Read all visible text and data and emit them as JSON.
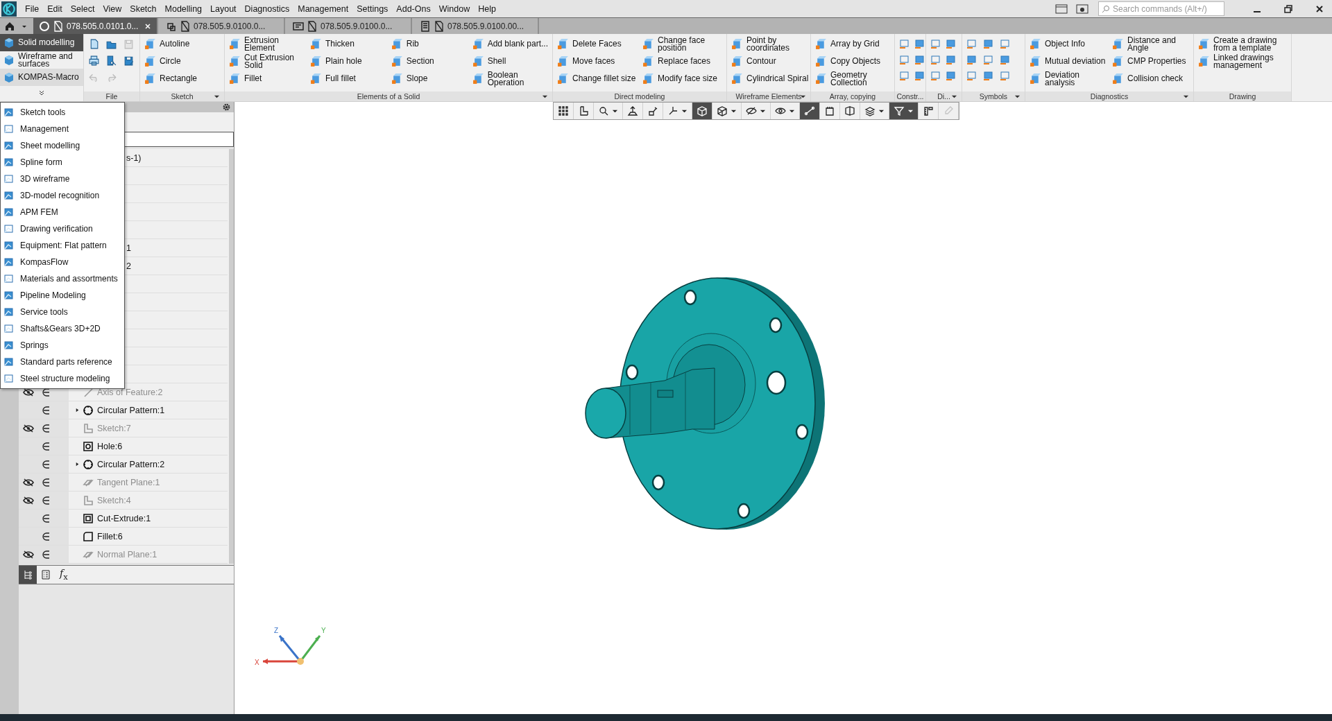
{
  "menu": [
    "File",
    "Edit",
    "Select",
    "View",
    "Sketch",
    "Modelling",
    "Layout",
    "Diagnostics",
    "Management",
    "Settings",
    "Add-Ons",
    "Window",
    "Help"
  ],
  "search": {
    "placeholder": "Search commands (Alt+/)"
  },
  "doc_tabs": [
    {
      "label": "078.505.0.0101.0...",
      "selected": true,
      "kind": "part"
    },
    {
      "label": "078.505.9.0100.0...",
      "selected": false,
      "kind": "assembly"
    },
    {
      "label": "078.505.9.0100.0...",
      "selected": false,
      "kind": "spec"
    },
    {
      "label": "078.505.9.0100.00...",
      "selected": false,
      "kind": "document"
    }
  ],
  "modes": [
    {
      "label": "Solid modelling",
      "selected": true
    },
    {
      "label": "Wireframe and surfaces",
      "selected": false
    },
    {
      "label": "KOMPAS-Macro",
      "selected": false
    }
  ],
  "groups": [
    {
      "kind": "file",
      "label": "File",
      "has_menu": false,
      "tools": [
        {
          "kind": "new",
          "disabled": false
        },
        {
          "kind": "open",
          "disabled": false
        },
        {
          "kind": "save",
          "disabled": true
        },
        {
          "kind": "print",
          "disabled": false
        },
        {
          "kind": "preview",
          "disabled": false
        },
        {
          "kind": "saveas",
          "disabled": false
        },
        {
          "kind": "undo",
          "disabled": true
        },
        {
          "kind": "redo",
          "disabled": true
        }
      ]
    },
    {
      "kind": "text",
      "label": "Sketch",
      "has_menu": true,
      "columns": [
        [
          "Autoline",
          "Circle",
          "Rectangle"
        ]
      ]
    },
    {
      "kind": "text",
      "label": "Elements of a Solid",
      "has_menu": true,
      "columns": [
        [
          "Extrusion Element",
          "Cut Extrusion Solid",
          "Fillet"
        ],
        [
          "Thicken",
          "Plain hole",
          "Full fillet"
        ],
        [
          "Rib",
          "Section",
          "Slope"
        ],
        [
          "Add blank part...",
          "Shell",
          "Boolean Operation"
        ]
      ]
    },
    {
      "kind": "text",
      "label": "Direct modeling",
      "has_menu": false,
      "columns": [
        [
          "Delete Faces",
          "Move faces",
          "Change fillet size"
        ],
        [
          "Change face position",
          "Replace faces",
          "Modify face size"
        ]
      ]
    },
    {
      "kind": "text",
      "label": "Wireframe Elements",
      "has_menu": true,
      "columns": [
        [
          "Point by coordinates",
          "Contour",
          "Cylindrical Spiral"
        ]
      ]
    },
    {
      "kind": "text",
      "label": "Array, copying",
      "has_menu": false,
      "columns": [
        [
          "Array by Grid",
          "Copy Objects",
          "Geometry Collection"
        ]
      ]
    },
    {
      "kind": "icons",
      "label": "Constr...",
      "has_menu": false
    },
    {
      "kind": "icons",
      "label": "Di...",
      "has_menu": true
    },
    {
      "kind": "icons",
      "label": "Symbols",
      "has_menu": true
    },
    {
      "kind": "text",
      "label": "Diagnostics",
      "has_menu": true,
      "columns": [
        [
          "Object Info",
          "Mutual deviation",
          "Deviation analysis"
        ],
        [
          "Distance and Angle",
          "CMP Properties",
          "Collision check"
        ]
      ]
    },
    {
      "kind": "text",
      "label": "Drawing",
      "has_menu": false,
      "columns": [
        [
          "Create a drawing from a template",
          "Linked drawings management"
        ]
      ]
    }
  ],
  "mode_menu": [
    "Sketch tools",
    "Management",
    "Sheet modelling",
    "Spline form",
    "3D wireframe",
    "3D-model recognition",
    "APM FEM",
    "Drawing verification",
    "Equipment: Flat pattern",
    "KompasFlow",
    "Materials and assortments",
    "Pipeline Modeling",
    "Service tools",
    "Shafts&Gears 3D+2D",
    "Springs",
    "Standard parts reference",
    "Steel structure modeling"
  ],
  "tree": [
    {
      "kind": "covered",
      "label": "s-1)"
    },
    {
      "kind": "covered"
    },
    {
      "kind": "covered"
    },
    {
      "kind": "covered"
    },
    {
      "kind": "covered"
    },
    {
      "kind": "covered",
      "label": "1"
    },
    {
      "kind": "covered",
      "label": "2"
    },
    {
      "kind": "covered"
    },
    {
      "kind": "covered"
    },
    {
      "kind": "covered"
    },
    {
      "kind": "covered"
    },
    {
      "kind": "covered"
    },
    {
      "kind": "covered"
    },
    {
      "kind": "axis",
      "label": "Axis of Feature:2",
      "hidden": true
    },
    {
      "kind": "pattern",
      "label": "Circular Pattern:1",
      "hidden": false,
      "expanded": false
    },
    {
      "kind": "sketch",
      "label": "Sketch:7",
      "hidden": true
    },
    {
      "kind": "hole",
      "label": "Hole:6",
      "hidden": false
    },
    {
      "kind": "pattern",
      "label": "Circular Pattern:2",
      "hidden": false,
      "expanded": false
    },
    {
      "kind": "plane",
      "label": "Tangent Plane:1",
      "hidden": true
    },
    {
      "kind": "sketch",
      "label": "Sketch:4",
      "hidden": true
    },
    {
      "kind": "extrude",
      "label": "Cut-Extrude:1",
      "hidden": false
    },
    {
      "kind": "fillet",
      "label": "Fillet:6",
      "hidden": false
    },
    {
      "kind": "plane",
      "label": "Normal Plane:1",
      "hidden": true
    }
  ],
  "tree_tabs": [
    {
      "kind": "tree",
      "selected": true
    },
    {
      "kind": "list",
      "selected": false
    },
    {
      "kind": "formula",
      "label": "*f*$_{x}$",
      "selected": false
    }
  ],
  "view_toolbar": [
    {
      "kind": "grip",
      "selected": false,
      "disabled": false,
      "menu": false
    },
    {
      "kind": "sketch",
      "selected": false,
      "disabled": false,
      "menu": false
    },
    {
      "kind": "zoom",
      "selected": false,
      "disabled": false,
      "menu": true
    },
    {
      "kind": "normal",
      "selected": false,
      "disabled": false,
      "menu": false
    },
    {
      "kind": "orient",
      "selected": false,
      "disabled": false,
      "menu": false
    },
    {
      "kind": "axes",
      "selected": false,
      "disabled": false,
      "menu": true
    },
    {
      "kind": "shaded",
      "selected": true,
      "disabled": false,
      "menu": false
    },
    {
      "kind": "wireframe",
      "selected": false,
      "disabled": false,
      "menu": true
    },
    {
      "kind": "hide",
      "selected": false,
      "disabled": false,
      "menu": true
    },
    {
      "kind": "show",
      "selected": false,
      "disabled": false,
      "menu": true
    },
    {
      "kind": "constraints",
      "selected": true,
      "disabled": false,
      "menu": false
    },
    {
      "kind": "sheet",
      "selected": false,
      "disabled": false,
      "menu": false
    },
    {
      "kind": "section",
      "selected": false,
      "disabled": false,
      "menu": false
    },
    {
      "kind": "layers",
      "selected": false,
      "disabled": false,
      "menu": true
    },
    {
      "kind": "filter",
      "selected": true,
      "disabled": false,
      "menu": true
    },
    {
      "kind": "measure",
      "selected": false,
      "disabled": false,
      "menu": false
    },
    {
      "kind": "pipette",
      "selected": false,
      "disabled": true,
      "menu": false
    }
  ],
  "axis_labels": [
    "Z",
    "Y",
    "X"
  ]
}
